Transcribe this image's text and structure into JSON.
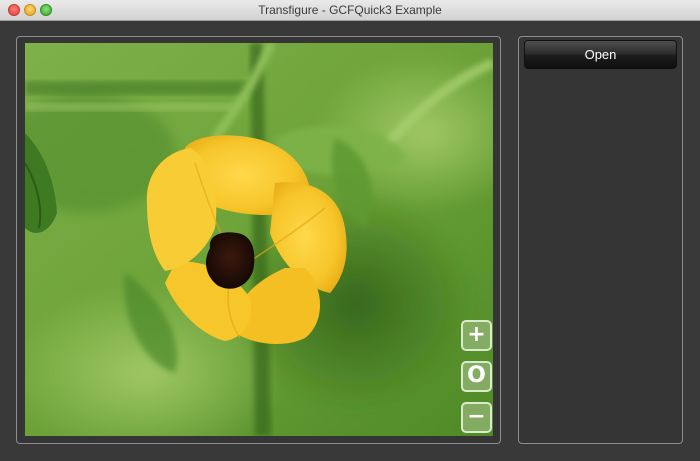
{
  "window": {
    "title": "Transfigure - GCFQuick3 Example"
  },
  "viewer": {
    "image_subject": "yellow flower with dark center on green leafy background",
    "zoom_in_label": "+",
    "zoom_reset_label": "O",
    "zoom_out_label": "−"
  },
  "sidebar": {
    "open_label": "Open"
  },
  "colors": {
    "window_bg": "#393939",
    "panel_border": "#8e8e8e",
    "petal_yellow": "#f5c82a",
    "flower_center": "#2a1208",
    "leaf_green": "#6fa23c",
    "button_dark": "#1c1c1c"
  },
  "icons": {
    "close": "close-icon",
    "minimize": "minimize-icon",
    "maximize": "maximize-icon"
  }
}
